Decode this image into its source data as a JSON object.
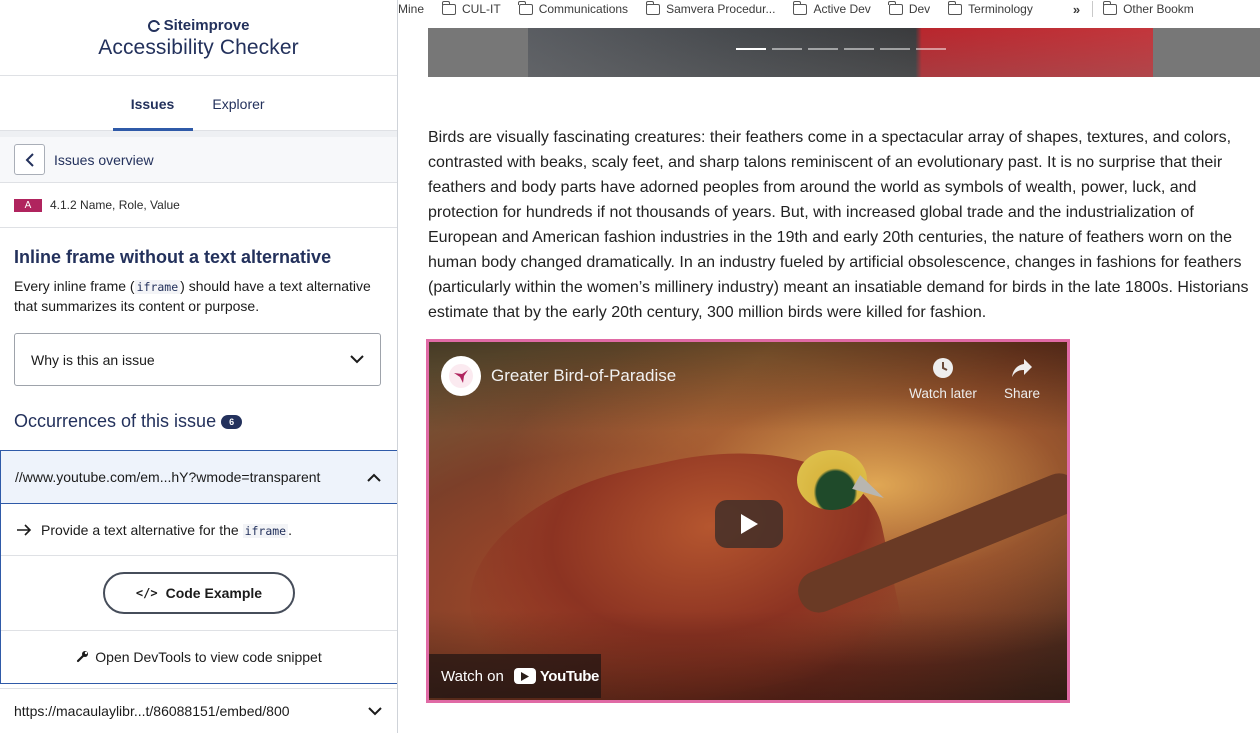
{
  "panel": {
    "brand_name": "Siteimprove",
    "app_title": "Accessibility Checker",
    "tabs": [
      {
        "label": "Issues",
        "active": true
      },
      {
        "label": "Explorer",
        "active": false
      }
    ],
    "overview_label": "Issues overview",
    "criterion": {
      "level": "A",
      "label": "4.1.2 Name, Role, Value"
    },
    "issue": {
      "title": "Inline frame without a text alternative",
      "desc_before": "Every inline frame (",
      "desc_code": "iframe",
      "desc_after": ") should have a text alternative that summarizes its content or purpose."
    },
    "why_label": "Why is this an issue",
    "occurrences": {
      "title": "Occurrences of this issue",
      "count": "6",
      "open_item": {
        "url": "//www.youtube.com/em...hY?wmode=transparent",
        "hint_before": "Provide a text alternative for the ",
        "hint_code": "iframe",
        "hint_after": ".",
        "code_button": "Code Example",
        "code_icon": "</>",
        "devtools_label": "Open DevTools to view code snippet"
      },
      "closed_item": {
        "url": "https://macaulaylibr...t/86088151/embed/800"
      }
    },
    "colors": {
      "brand": "#23315c",
      "accent": "#2f5aa8",
      "level_a": "#b0245e"
    }
  },
  "browser": {
    "bookmarks": [
      "Mine",
      "CUL-IT",
      "Communications",
      "Samvera Procedur...",
      "Active Dev",
      "Dev",
      "Terminology"
    ],
    "bookmarks_more": "»",
    "other_bookmarks": "Other Bookm",
    "carousel": {
      "slides": 6,
      "active": 1
    },
    "article_text": "Birds are visually fascinating creatures: their feathers come in a spectacular array of shapes, textures, and colors, contrasted with beaks, scaly feet, and sharp talons reminiscent of an evolutionary past. It is no surprise that their feathers and body parts have adorned peoples from around the world as symbols of wealth, power, luck, and protection for hundreds if not thousands of years. But, with increased global trade and the industrialization of European and American fashion industries in the 19th and early 20th centuries, the nature of feathers worn on the human body changed dramatically. In an industry fueled by artificial obsolescence, changes in fashions for feathers (particularly within the women’s millinery industry) meant an insatiable demand for birds in the late 1800s. Historians estimate that by the early 20th century, 300 million birds were killed for fashion.",
    "video": {
      "title": "Greater Bird-of-Paradise",
      "watch_later": "Watch later",
      "share": "Share",
      "watch_on": "Watch on",
      "youtube": "YouTube",
      "highlight_color": "#e06aa5"
    }
  }
}
